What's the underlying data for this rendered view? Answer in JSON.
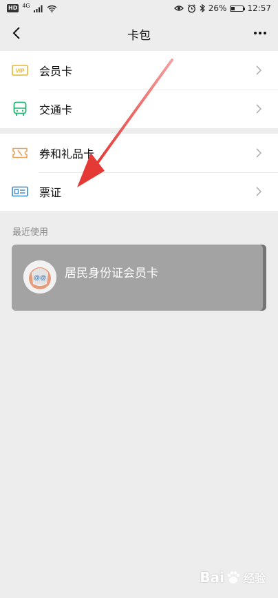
{
  "statusbar": {
    "hd": "HD",
    "network": "4G",
    "battery_text": "26%",
    "battery_level": 0.26,
    "time": "12:57"
  },
  "nav": {
    "title": "卡包"
  },
  "groups": [
    {
      "items": [
        {
          "label": "会员卡",
          "icon": "vip-icon"
        },
        {
          "label": "交通卡",
          "icon": "bus-icon"
        }
      ]
    },
    {
      "items": [
        {
          "label": "券和礼品卡",
          "icon": "coupon-icon"
        },
        {
          "label": "票证",
          "icon": "id-card-icon"
        }
      ]
    }
  ],
  "recent": {
    "label": "最近使用",
    "cards": [
      {
        "title": "居民身份证会员卡",
        "avatar": "avatar-icon"
      }
    ]
  },
  "watermark": {
    "brand": "Bai",
    "sub": "经验"
  },
  "colors": {
    "background": "#ededed",
    "vip_yellow": "#e8b632",
    "bus_green": "#22b573",
    "coupon_orange": "#e8a25a",
    "id_blue": "#3a88c8",
    "card_gray": "#a3a3a3",
    "arrow_red": "#e53935"
  }
}
